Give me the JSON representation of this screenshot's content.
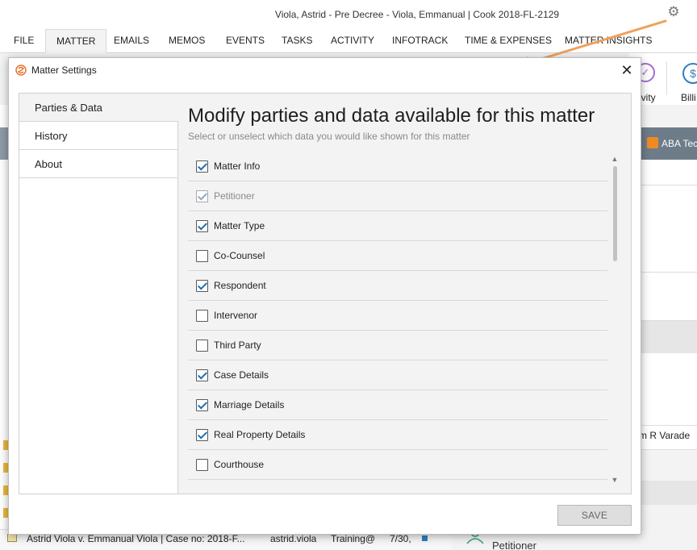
{
  "window": {
    "title": "Viola, Astrid - Pre Decree - Viola, Emmanual | Cook 2018-FL-2129"
  },
  "menu": [
    {
      "label": "FILE",
      "active": false
    },
    {
      "label": "MATTER",
      "active": true
    },
    {
      "label": "EMAILS",
      "active": false
    },
    {
      "label": "MEMOS",
      "active": false
    },
    {
      "label": "EVENTS",
      "active": false
    },
    {
      "label": "TASKS",
      "active": false
    },
    {
      "label": "ACTIVITY",
      "active": false
    },
    {
      "label": "INFOTRACK",
      "active": false
    },
    {
      "label": "TIME & EXPENSES",
      "active": false
    },
    {
      "label": "MATTER INSIGHTS",
      "active": false
    }
  ],
  "ribbon": {
    "activity_label": "ivity",
    "billing_label": "Billi",
    "billing_icon": "dollar-icon",
    "activity_icon": "check-circle-icon"
  },
  "background": {
    "darkbar_tab": "ABA Tech S",
    "contact_name": "m R Varade",
    "bottom_row": {
      "matter": "Astrid Viola v. Emmanual Viola | Case no: 2018-F...",
      "user": "astrid.viola",
      "category": "Training@",
      "date": "7/30,"
    },
    "petitioner_label": "Petitioner"
  },
  "modal": {
    "title": "Matter Settings",
    "close_icon": "close-icon",
    "nav": [
      {
        "label": "Parties & Data",
        "selected": true
      },
      {
        "label": "History",
        "selected": false
      },
      {
        "label": "About",
        "selected": false
      }
    ],
    "heading": "Modify parties and data available for this matter",
    "subheading": "Select or unselect which data you would like shown for this matter",
    "items": [
      {
        "label": "Matter Info",
        "checked": true,
        "disabled": false
      },
      {
        "label": "Petitioner",
        "checked": true,
        "disabled": true
      },
      {
        "label": "Matter Type",
        "checked": true,
        "disabled": false
      },
      {
        "label": "Co-Counsel",
        "checked": false,
        "disabled": false
      },
      {
        "label": "Respondent",
        "checked": true,
        "disabled": false
      },
      {
        "label": "Intervenor",
        "checked": false,
        "disabled": false
      },
      {
        "label": "Third Party",
        "checked": false,
        "disabled": false
      },
      {
        "label": "Case Details",
        "checked": true,
        "disabled": false
      },
      {
        "label": "Marriage Details",
        "checked": true,
        "disabled": false
      },
      {
        "label": "Real Property Details",
        "checked": true,
        "disabled": false
      },
      {
        "label": "Courthouse",
        "checked": false,
        "disabled": false
      }
    ],
    "save_label": "SAVE",
    "accent_color": "#1f6fb4",
    "logo_color": "#e8732a"
  },
  "annotation": {
    "arrow_color": "#f0a05a"
  }
}
